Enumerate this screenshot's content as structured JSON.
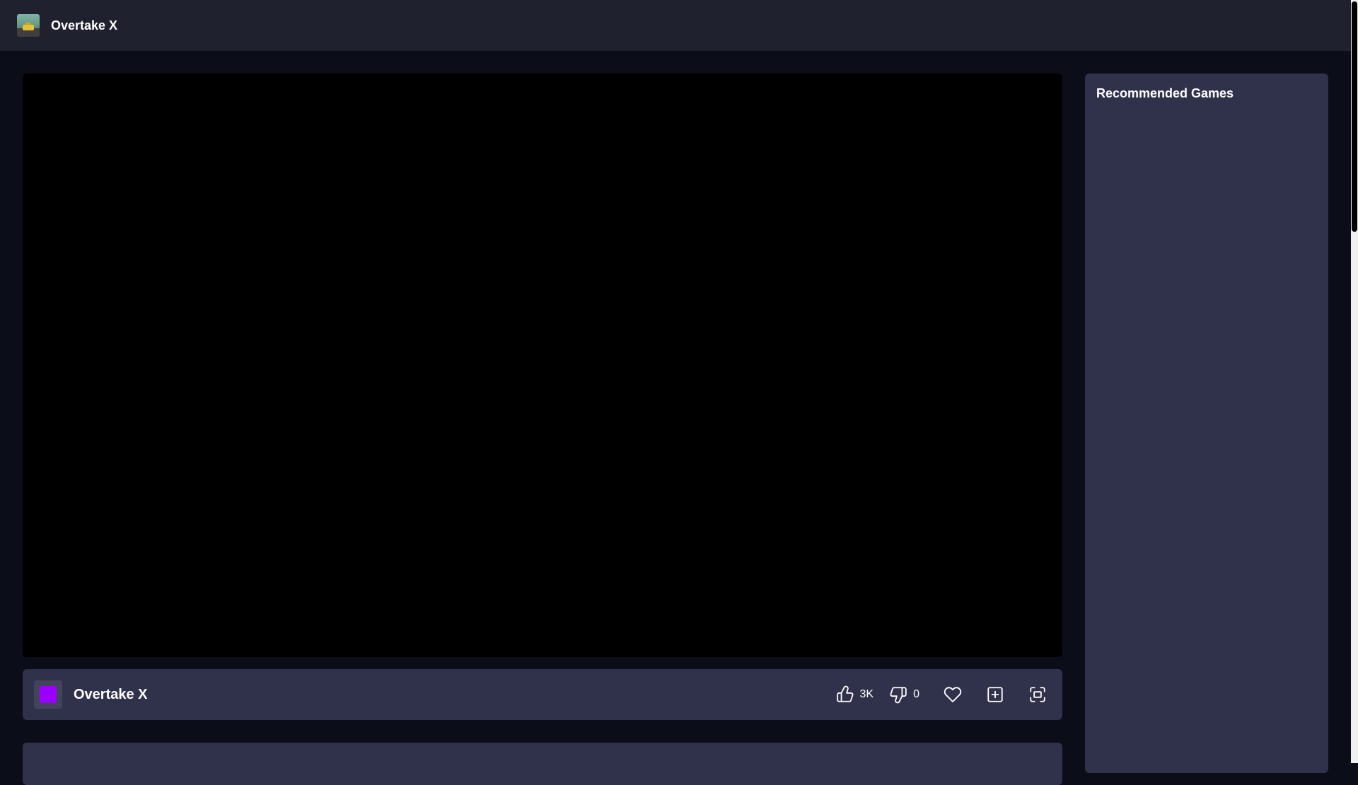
{
  "header": {
    "title": "Overtake X",
    "logo_icon": "game-thumbnail-icon"
  },
  "game": {
    "title": "Overtake X",
    "icon_color": "#9900ff"
  },
  "actions": {
    "like_count": "3K",
    "dislike_count": "0"
  },
  "sidebar": {
    "title": "Recommended Games"
  },
  "colors": {
    "background": "#0b0d18",
    "topbar": "#20212e",
    "panel": "#30314a",
    "player": "#000000"
  }
}
